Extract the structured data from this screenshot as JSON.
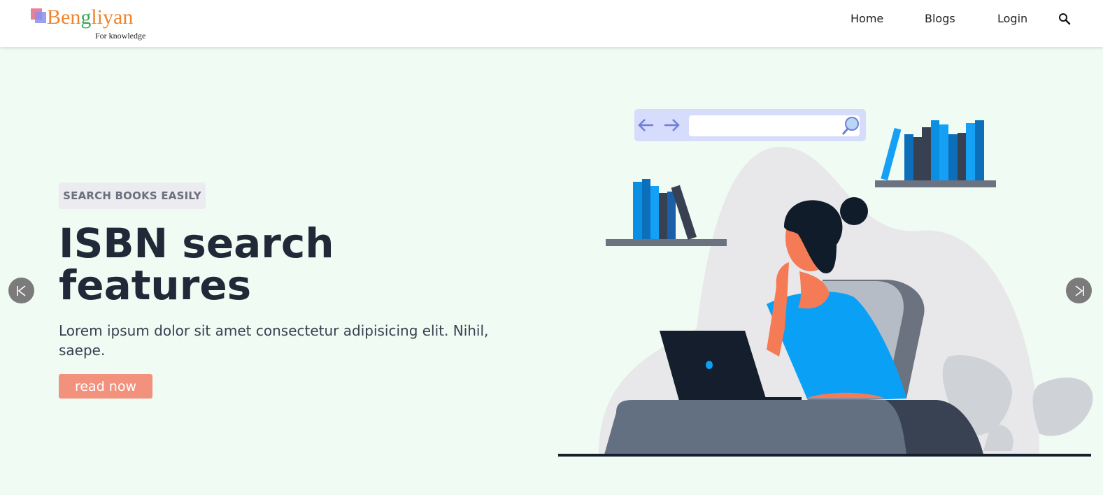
{
  "header": {
    "logo": {
      "name_part1": "Ben",
      "name_part2": "g",
      "name_part3": "liyan",
      "tagline": "For knowledge"
    },
    "nav": [
      {
        "label": "Home"
      },
      {
        "label": "Blogs"
      },
      {
        "label": "Login"
      }
    ],
    "search_icon": "search-icon"
  },
  "hero": {
    "badge": "SEARCH BOOKS EASILY",
    "title_line1": "ISBN search",
    "title_line2": "features",
    "description": "Lorem ipsum dolor sit amet consectetur adipisicing elit. Nihil, saepe.",
    "cta": "read now"
  },
  "carousel": {
    "prev_icon": "skip-previous-icon",
    "next_icon": "skip-next-icon"
  },
  "colors": {
    "background": "#effbf3",
    "accent": "#f2917c",
    "title": "#1f2937",
    "logo_orange": "#f0852d",
    "logo_green": "#3aa757"
  }
}
